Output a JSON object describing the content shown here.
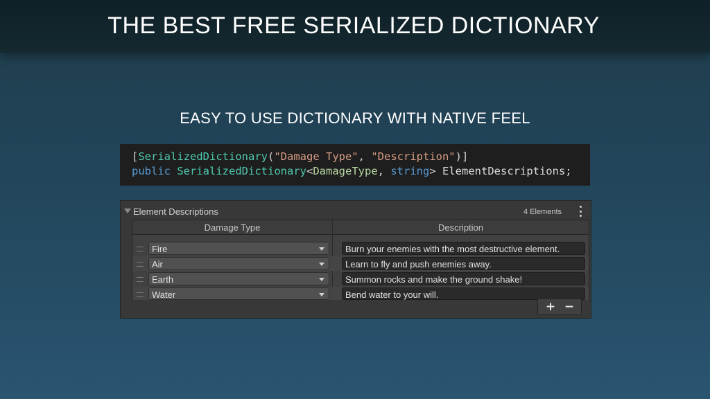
{
  "header": {
    "title": "THE BEST FREE SERIALIZED DICTIONARY"
  },
  "subtitle": "EASY TO USE DICTIONARY WITH NATIVE FEEL",
  "code": {
    "line1": {
      "open": "[",
      "attr": "SerializedDictionary",
      "paren_open": "(",
      "str1": "\"Damage Type\"",
      "comma": ", ",
      "str2": "\"Description\"",
      "close": ")]"
    },
    "line2": {
      "kw": "public",
      "type": "SerializedDictionary",
      "lt": "<",
      "gen1": "DamageType",
      "comma": ", ",
      "gen2": "string",
      "gt": ">",
      "ident": " ElementDescriptions;"
    }
  },
  "inspector": {
    "title": "Element Descriptions",
    "count": "4 Elements",
    "columns": {
      "key": "Damage Type",
      "value": "Description"
    },
    "rows": [
      {
        "key": "Fire",
        "value": "Burn your enemies with the most destructive element."
      },
      {
        "key": "Air",
        "value": "Learn to fly and push enemies away."
      },
      {
        "key": "Earth",
        "value": "Summon rocks and make the ground shake!"
      },
      {
        "key": "Water",
        "value": "Bend water to your will."
      }
    ],
    "add_label": "+",
    "remove_label": "−"
  },
  "icons": {
    "foldout": "triangle-down-icon",
    "menu": "kebab-menu-icon",
    "drag": "drag-handle-icon",
    "dropdown": "chevron-down-icon"
  }
}
